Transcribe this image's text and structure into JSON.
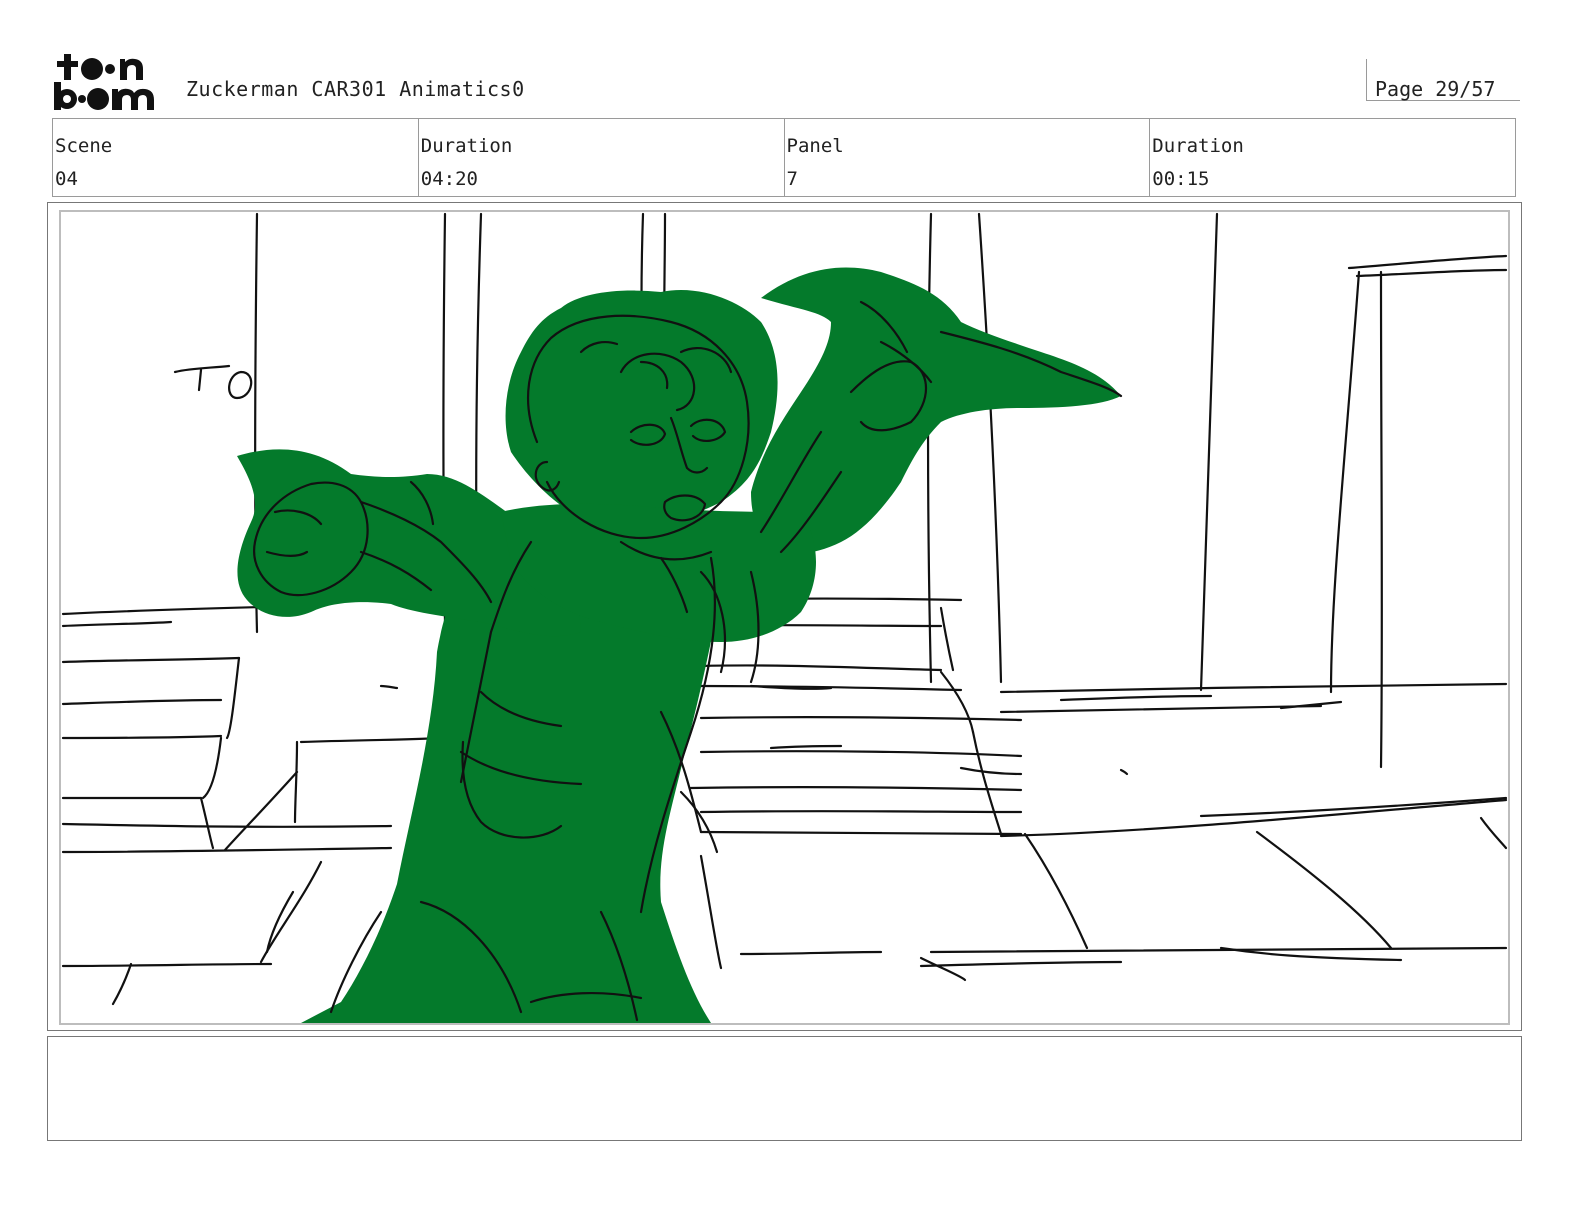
{
  "header": {
    "logo_text": "toonboom",
    "project_title": "Zuckerman CAR301 Animatics0",
    "page_label": "Page 29/57"
  },
  "info": {
    "scene_label": "Scene",
    "scene_value": "04",
    "scene_duration_label": "Duration",
    "scene_duration_value": "04:20",
    "panel_label": "Panel",
    "panel_value": "7",
    "panel_duration_label": "Duration",
    "panel_duration_value": "00:15"
  },
  "panel": {
    "sketch_fill_color": "#047a2b",
    "line_color": "#111111"
  },
  "notes": {
    "text": ""
  }
}
